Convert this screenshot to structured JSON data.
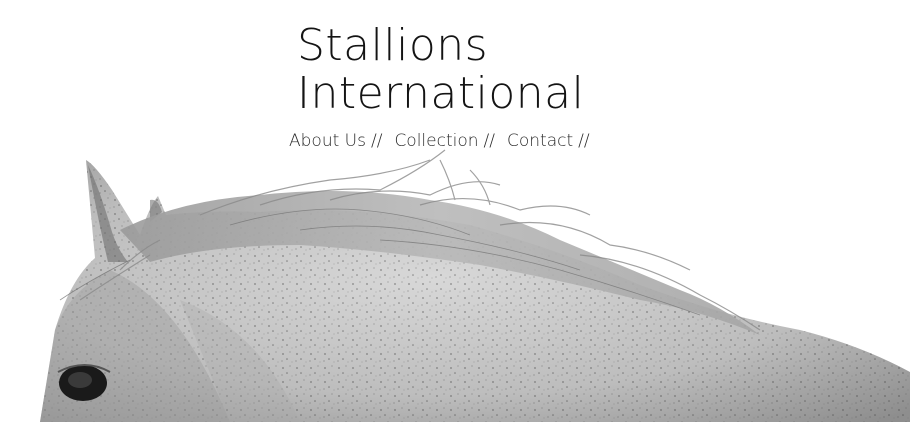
{
  "site": {
    "title_line1": "Stallions",
    "title_line2": "International"
  },
  "nav": {
    "items": [
      {
        "label": "About Us",
        "separator": "//"
      },
      {
        "label": "Collection",
        "separator": "//"
      },
      {
        "label": "Contact",
        "separator": "//"
      }
    ]
  },
  "hero": {
    "image_subject": "white horse head and mane, black and white"
  }
}
